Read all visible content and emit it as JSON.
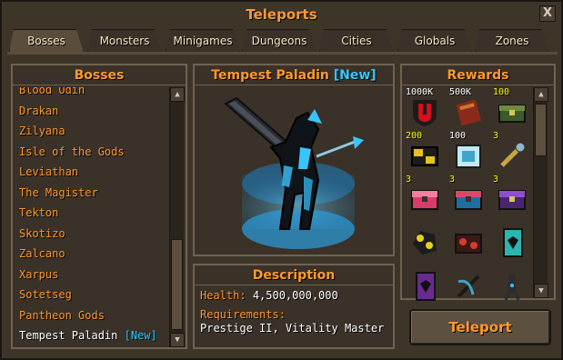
{
  "window": {
    "title": "Teleports",
    "close_label": "X"
  },
  "tabs": [
    {
      "label": "Bosses",
      "active": true
    },
    {
      "label": "Monsters",
      "active": false
    },
    {
      "label": "Minigames",
      "active": false
    },
    {
      "label": "Dungeons",
      "active": false
    },
    {
      "label": "Cities",
      "active": false
    },
    {
      "label": "Globals",
      "active": false
    },
    {
      "label": "Zones",
      "active": false
    }
  ],
  "bosses": {
    "header": "Bosses",
    "items": [
      {
        "label": "Blood Odin"
      },
      {
        "label": "Drakan"
      },
      {
        "label": "Zilyana"
      },
      {
        "label": "Isle of the Gods"
      },
      {
        "label": "Leviathan"
      },
      {
        "label": "The Magister"
      },
      {
        "label": "Tekton"
      },
      {
        "label": "Skotizo"
      },
      {
        "label": "Zalcano"
      },
      {
        "label": "Xarpus"
      },
      {
        "label": "Sotetseg"
      },
      {
        "label": "Pantheon Gods"
      },
      {
        "label": "Tempest Paladin",
        "tag": "[New]",
        "selected": true
      }
    ]
  },
  "preview": {
    "name": "Tempest Paladin",
    "tag": "[New]"
  },
  "description": {
    "header": "Description",
    "health_label": "Health:",
    "health_value": "4,500,000,000",
    "requirements_label": "Requirements:",
    "requirements_value": "Prestige II, Vitality Master"
  },
  "rewards": {
    "header": "Rewards",
    "items": [
      {
        "icon": "red-u-shield-icon",
        "qty": "1000K",
        "qty_color": "white"
      },
      {
        "icon": "red-scroll-icon",
        "qty": "500K",
        "qty_color": "white"
      },
      {
        "icon": "green-chest-icon",
        "qty": "100",
        "qty_color": "yellow"
      },
      {
        "icon": "gold-chest-icon",
        "qty": "200",
        "qty_color": "yellow"
      },
      {
        "icon": "ice-box-icon",
        "qty": "100",
        "qty_color": "yellow"
      },
      {
        "icon": "golden-key-icon",
        "qty": "3",
        "qty_color": "yellow"
      },
      {
        "icon": "pink-chest-icon",
        "qty": "3",
        "qty_color": "yellow"
      },
      {
        "icon": "blue-chest-icon",
        "qty": "3",
        "qty_color": "yellow"
      },
      {
        "icon": "purple-chest-icon",
        "qty": "3",
        "qty_color": "yellow"
      },
      {
        "icon": "gold-ore-icon",
        "qty": "",
        "qty_color": "yellow"
      },
      {
        "icon": "red-ore-chest-icon",
        "qty": "",
        "qty_color": "yellow"
      },
      {
        "icon": "teal-card-icon",
        "qty": "",
        "qty_color": "yellow"
      },
      {
        "icon": "purple-card-icon",
        "qty": "",
        "qty_color": "yellow"
      },
      {
        "icon": "crossbow-icon",
        "qty": "",
        "qty_color": "yellow"
      },
      {
        "icon": "humanoid-pet-icon",
        "qty": "",
        "qty_color": "yellow"
      }
    ]
  },
  "teleport_button": {
    "label": "Teleport"
  },
  "colors": {
    "accent": "#ff9a2e",
    "new_tag": "#35c8ff",
    "qty": "#ffff00"
  }
}
